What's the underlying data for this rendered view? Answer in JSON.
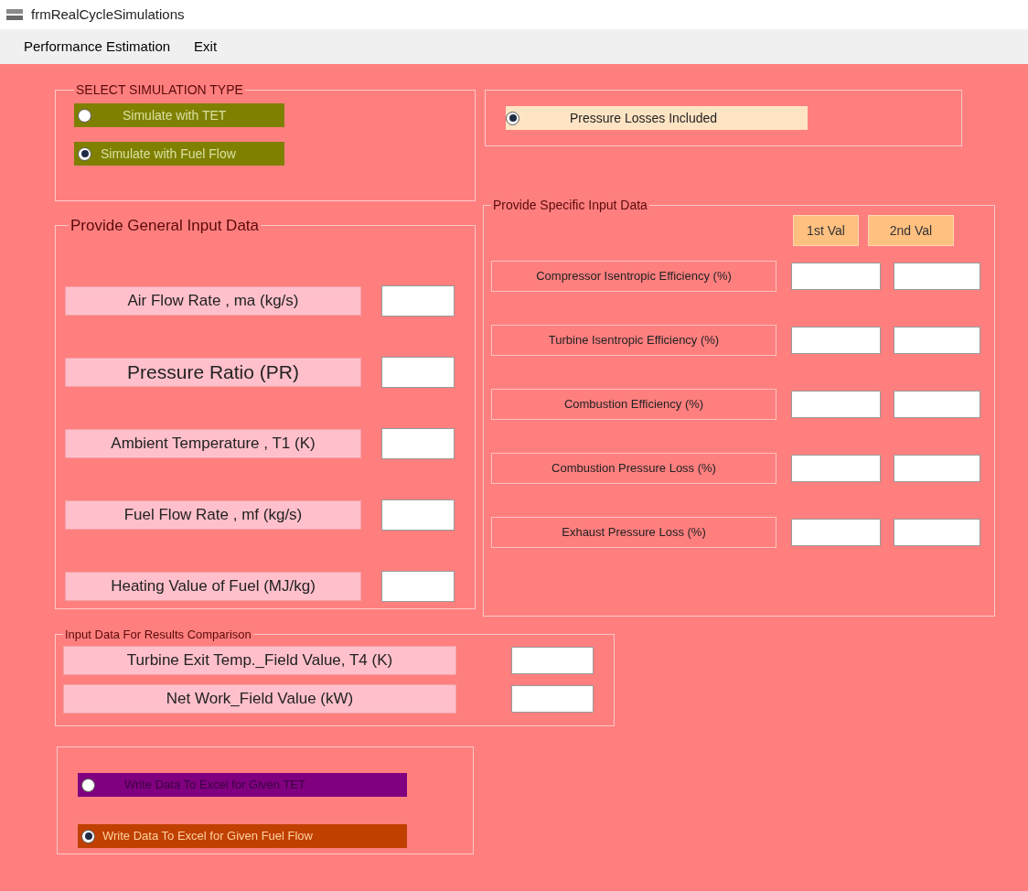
{
  "window": {
    "title": "frmRealCycleSimulations"
  },
  "menu": [
    "Performance Estimation",
    "Exit"
  ],
  "simulation_type": {
    "title": "SELECT SIMULATION TYPE",
    "options": [
      {
        "label": "Simulate with TET",
        "selected": false
      },
      {
        "label": "Simulate with Fuel Flow",
        "selected": true
      }
    ]
  },
  "pressure_losses": {
    "label": "Pressure Losses Included",
    "selected": true
  },
  "general_input": {
    "title": "Provide General Input Data",
    "fields": [
      "Air Flow Rate , ma (kg/s)",
      "Pressure Ratio (PR)",
      "Ambient Temperature , T1 (K)",
      "Fuel Flow Rate , mf (kg/s)",
      "Heating Value of Fuel (MJ/kg)"
    ]
  },
  "specific_input": {
    "title": "Provide Specific Input Data",
    "columns": [
      "1st Val",
      "2nd Val"
    ],
    "fields": [
      "Compressor Isentropic Efficiency (%)",
      "Turbine Isentropic Efficiency (%)",
      "Combustion Efficiency (%)",
      "Combustion Pressure Loss (%)",
      "Exhaust Pressure Loss (%)"
    ]
  },
  "comparison": {
    "title": "Input Data For Results Comparison",
    "fields": [
      "Turbine Exit Temp._Field Value, T4 (K)",
      "Net Work_Field Value (kW)"
    ]
  },
  "export": {
    "options": [
      {
        "label": "Write Data To Excel for Given TET",
        "selected": false,
        "color": "#800080"
      },
      {
        "label": "Write Data To Excel for Given Fuel Flow",
        "selected": true,
        "color": "#c04000"
      }
    ]
  }
}
